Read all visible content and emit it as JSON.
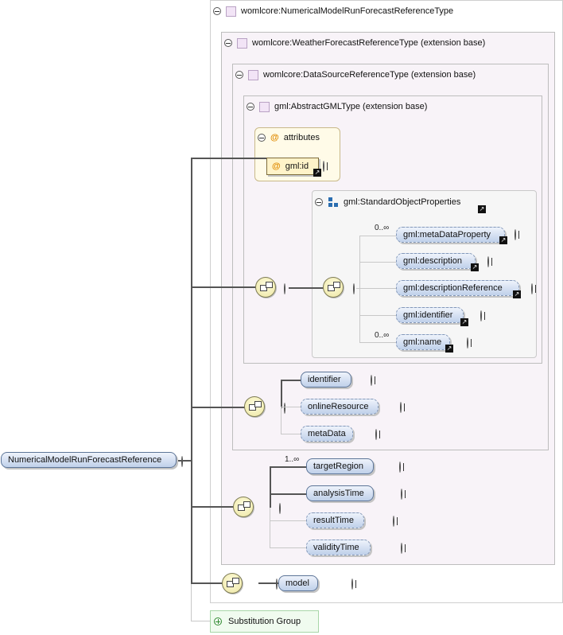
{
  "root": {
    "label": "NumericalModelRunForecastReference"
  },
  "types": {
    "t1": "womlcore:NumericalModelRunForecastReferenceType",
    "t2": "womlcore:WeatherForecastReferenceType (extension base)",
    "t3": "womlcore:DataSourceReferenceType (extension base)",
    "t4": "gml:AbstractGMLType (extension base)"
  },
  "attributes": {
    "title": "attributes",
    "gml_id": "gml:id",
    "icon": "@"
  },
  "standard_props": {
    "title": "gml:StandardObjectProperties",
    "items": [
      {
        "label": "gml:metaDataProperty",
        "card": "0..∞"
      },
      {
        "label": "gml:description",
        "card": ""
      },
      {
        "label": "gml:descriptionReference",
        "card": ""
      },
      {
        "label": "gml:identifier",
        "card": ""
      },
      {
        "label": "gml:name",
        "card": "0..∞"
      }
    ]
  },
  "datasource_seq": {
    "items": [
      "identifier",
      "onlineResource",
      "metaData"
    ]
  },
  "weather_seq": {
    "items": [
      "targetRegion",
      "analysisTime",
      "resultTime",
      "validityTime"
    ],
    "card_first": "1..∞"
  },
  "model_seq": {
    "items": [
      "model"
    ]
  },
  "substitution": {
    "label": "Substitution Group"
  },
  "colors": {
    "element_fill": "#bfd0ea",
    "type_bg": "#f8f3f8",
    "attr_bg": "#fffbe8",
    "seq_fill": "#ece5a0"
  }
}
